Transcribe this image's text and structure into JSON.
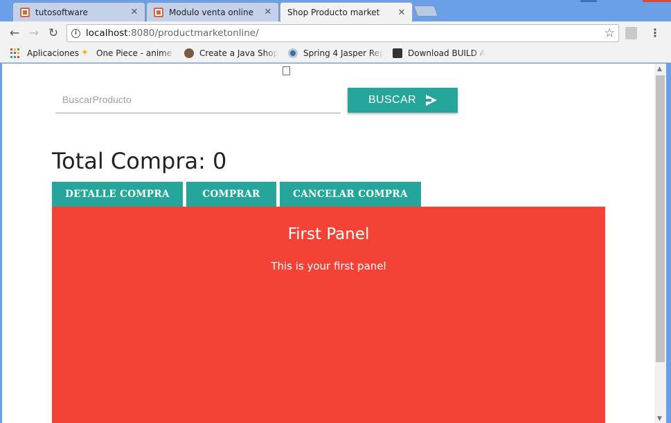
{
  "browser": {
    "tabs": [
      {
        "label": "tutosoftware",
        "icon": "xampp-icon",
        "active": false
      },
      {
        "label": "Modulo venta online",
        "icon": "xampp-icon",
        "active": false
      },
      {
        "label": "Shop Producto market",
        "icon": "page-icon",
        "active": true
      }
    ],
    "close_glyph": "✕",
    "url_host": "localhost",
    "url_rest": ":8080/productmarketonline/",
    "bookmarks": [
      {
        "label": "Aplicaciones",
        "icon": "apps-icon"
      },
      {
        "label": "One Piece - anime On",
        "icon": "star-bookmark-icon"
      },
      {
        "label": "Create a Java Shoppin",
        "icon": "avatar-bookmark-icon"
      },
      {
        "label": "Spring 4 Jasper Repo",
        "icon": "circle-bookmark-icon"
      },
      {
        "label": "Download BUILD AN",
        "icon": "box-bookmark-icon"
      }
    ]
  },
  "page": {
    "search": {
      "placeholder": "BuscarProducto",
      "value": "",
      "button_label": "BUSCAR"
    },
    "total": {
      "label": "Total Compra:",
      "value": "0"
    },
    "tabs": [
      {
        "label": "DETALLE COMPRA"
      },
      {
        "label": "COMPRAR"
      },
      {
        "label": "CANCELAR COMPRA"
      }
    ],
    "panel": {
      "title": "First Panel",
      "text": "This is your first panel"
    }
  },
  "colors": {
    "accent": "#26a69a",
    "panel": "#f44336",
    "chrome_frame": "#6aa0e8"
  }
}
